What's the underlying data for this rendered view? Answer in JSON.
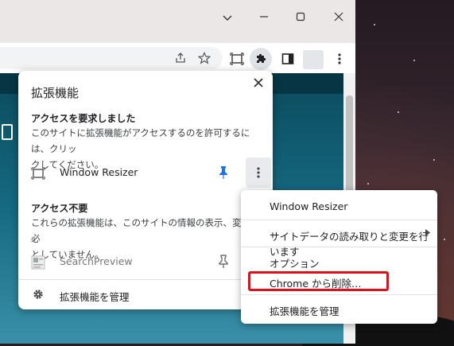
{
  "popup": {
    "title": "拡張機能",
    "requested_section": {
      "heading": "アクセスを要求しました",
      "description_line1": "このサイトに拡張機能がアクセスするのを許可するには、クリッ",
      "description_line2": "クしてください。"
    },
    "requested_extensions": [
      {
        "name": "Window Resizer",
        "icon": "window-resize-icon",
        "pinned": true
      }
    ],
    "not_needed_section": {
      "heading": "アクセス不要",
      "description_line1": "これらの拡張機能は、このサイトの情報の表示、変更を必",
      "description_line2": "としていません。"
    },
    "not_needed_extensions": [
      {
        "name": "SearchPreview",
        "icon": "search-preview-icon",
        "pinned": false
      }
    ],
    "manage_label": "拡張機能を管理"
  },
  "context_menu": {
    "items": [
      {
        "label": "Window Resizer"
      },
      {
        "label": "サイトデータの読み取りと変更を行います",
        "has_submenu": true
      },
      {
        "label": "オプション"
      },
      {
        "label": "Chrome から削除…",
        "highlighted": true
      },
      {
        "label": "拡張機能を管理"
      }
    ]
  },
  "colors": {
    "pin_active": "#1a73e8",
    "highlight_border": "#e0101a",
    "page_background": "#0a4a5c"
  }
}
